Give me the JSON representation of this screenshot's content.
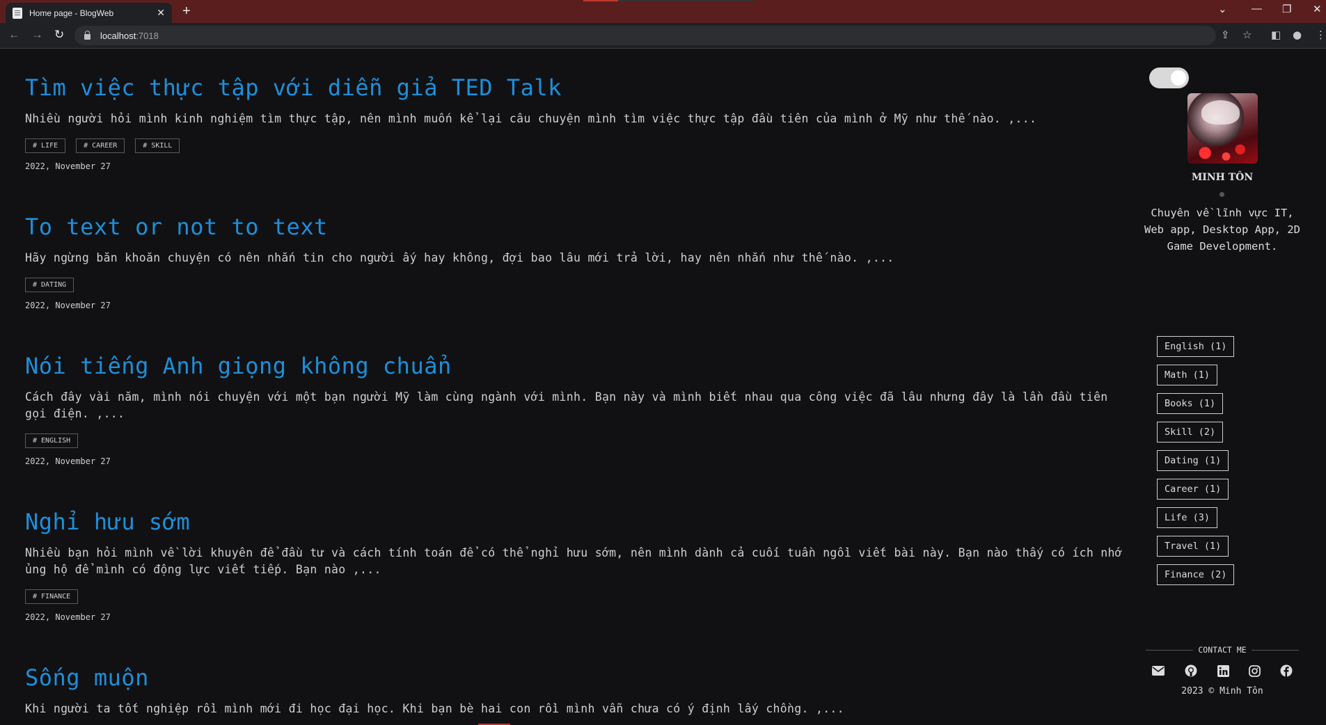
{
  "browser": {
    "tab_title": "Home page - BlogWeb",
    "tab_close": "✕",
    "new_tab": "+",
    "url_host": "localhost",
    "url_port": ":7018",
    "window_controls": [
      "⌄",
      "—",
      "❐",
      "✕"
    ]
  },
  "posts": [
    {
      "title": "Tìm việc thực tập với diễn giả TED Talk",
      "excerpt": "Nhiều người hỏi mình kinh nghiệm tìm thực tập, nên mình muốn kể lại câu chuyện mình tìm việc thực tập đầu tiên của mình ở Mỹ như thế nào. ,...",
      "tags": [
        "# LIFE",
        "# CAREER",
        "# SKILL"
      ],
      "date": "2022, November 27"
    },
    {
      "title": "To text or not to text",
      "excerpt": "Hãy ngừng băn khoăn chuyện có nên nhắn tin cho người ấy hay không, đợi bao lâu mới trả lời, hay nên nhắn như thế nào. ,...",
      "tags": [
        "# DATING"
      ],
      "date": "2022, November 27"
    },
    {
      "title": "Nói tiếng Anh giọng không chuẩn",
      "excerpt": "Cách đây vài năm, mình nói chuyện với một bạn người Mỹ làm cùng ngành với mình. Bạn này và mình biết nhau qua công việc đã lâu nhưng đây là lần đầu tiên gọi điện. ,...",
      "tags": [
        "# ENGLISH"
      ],
      "date": "2022, November 27"
    },
    {
      "title": "Nghỉ hưu sớm",
      "excerpt": "Nhiều bạn hỏi mình về lời khuyên để đầu tư và cách tính toán để có thể nghỉ hưu sớm, nên mình dành cả cuối tuần ngồi viết bài này. Bạn nào thấy có ích nhớ ủng hộ để mình có động lực viết tiếp. Bạn nào ,...",
      "tags": [
        "# FINANCE"
      ],
      "date": "2022, November 27"
    },
    {
      "title": "Sống muộn",
      "excerpt": "Khi người ta tốt nghiệp rồi mình mới đi học đại học. Khi bạn bè hai con rồi mình vẫn chưa có ý định lấy chồng. ,...",
      "tags": [],
      "date": ""
    }
  ],
  "profile": {
    "name": "MINH TÔN",
    "bio": "Chuyên về lĩnh vực IT, Web app, Desktop App, 2D Game Development."
  },
  "categories": [
    "English (1)",
    "Math (1)",
    "Books (1)",
    "Skill (2)",
    "Dating (1)",
    "Career (1)",
    "Life (3)",
    "Travel (1)",
    "Finance (2)"
  ],
  "contact": {
    "title": "CONTACT ME",
    "socials": [
      "mail-icon",
      "github-icon",
      "linkedin-icon",
      "instagram-icon",
      "facebook-icon"
    ],
    "copyright": "2023 © Minh Tôn"
  },
  "colors": {
    "accent": "#1e8fda",
    "background": "#111113",
    "tabbar": "#5b1e1f"
  }
}
